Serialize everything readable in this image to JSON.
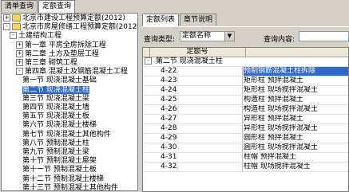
{
  "left_tabs": [
    "清单查询",
    "定额查询"
  ],
  "right_tabs": [
    "定额列表",
    "章节说明"
  ],
  "tree": [
    {
      "label": "北京市建设工程预算定额(2012)",
      "indent": 0,
      "exp": "+",
      "folder": true
    },
    {
      "label": "北京市房屋修缮工程预算定额(2012)",
      "indent": 0,
      "exp": "-",
      "folder": true
    },
    {
      "label": "土建结构工程",
      "indent": 1,
      "exp": "-",
      "folder": false
    },
    {
      "label": "第一章  平房全房拆除工程",
      "indent": 2,
      "exp": "+",
      "folder": false
    },
    {
      "label": "第二章  土方及垫层工程",
      "indent": 2,
      "exp": "+",
      "folder": false
    },
    {
      "label": "第三章  砌筑工程",
      "indent": 2,
      "exp": "+",
      "folder": false
    },
    {
      "label": "第四章  混凝土及钢筋混凝土工程",
      "indent": 2,
      "exp": "-",
      "folder": false
    },
    {
      "label": "第一节  现浇混凝土基础",
      "indent": 3,
      "exp": "",
      "folder": false
    },
    {
      "label": "第二节  现浇混凝土柱",
      "indent": 3,
      "exp": "",
      "folder": false,
      "selected": true
    },
    {
      "label": "第三节  现浇混凝土梁",
      "indent": 3,
      "exp": "",
      "folder": false
    },
    {
      "label": "第四节  现浇混凝土墙",
      "indent": 3,
      "exp": "",
      "folder": false
    },
    {
      "label": "第五节  现浇混凝土板",
      "indent": 3,
      "exp": "",
      "folder": false
    },
    {
      "label": "第六节  现浇混凝土楼梯",
      "indent": 3,
      "exp": "",
      "folder": false
    },
    {
      "label": "第七节  现浇混凝土其他构件",
      "indent": 3,
      "exp": "",
      "folder": false
    },
    {
      "label": "第八节  预制混凝土柱",
      "indent": 3,
      "exp": "",
      "folder": false
    },
    {
      "label": "第九节  预制混凝土梁",
      "indent": 3,
      "exp": "",
      "folder": false
    },
    {
      "label": "第十节  预制混凝土屋架",
      "indent": 3,
      "exp": "",
      "folder": false
    },
    {
      "label": "第十一节  预制混凝土板",
      "indent": 3,
      "exp": "",
      "folder": false
    },
    {
      "label": "第十二节  预制混凝土楼梯",
      "indent": 3,
      "exp": "",
      "folder": false
    },
    {
      "label": "第十三节  预制混凝土其他构件",
      "indent": 3,
      "exp": "",
      "folder": false
    }
  ],
  "query": {
    "type_label": "查询类型:",
    "type_value": "定额名称",
    "content_label": "查询内容:",
    "content_value": ""
  },
  "grid": {
    "header": "定额号",
    "group": "第二节  现浇混凝土柱",
    "rows": [
      {
        "num": "4-22",
        "name": "预制钢筋混凝土柱拆除",
        "selected": true
      },
      {
        "num": "4-23",
        "name": "矩形柱  预拌混凝土"
      },
      {
        "num": "4-24",
        "name": "矩形柱  现场搅拌混凝土"
      },
      {
        "num": "4-25",
        "name": "构造柱  预拌混凝土"
      },
      {
        "num": "4-26",
        "name": "构造柱  现场搅拌混凝土"
      },
      {
        "num": "4-27",
        "name": "异形柱  预拌混凝土"
      },
      {
        "num": "4-28",
        "name": "异形柱  现场搅拌混凝土"
      },
      {
        "num": "4-29",
        "name": "圆形柱  预拌混凝土"
      },
      {
        "num": "4-30",
        "name": "圆形柱  现场搅拌混凝土"
      },
      {
        "num": "4-31",
        "name": "柱帽  预拌混凝土"
      },
      {
        "num": "4-32",
        "name": "柱帽  现场搅拌混凝土"
      }
    ]
  }
}
